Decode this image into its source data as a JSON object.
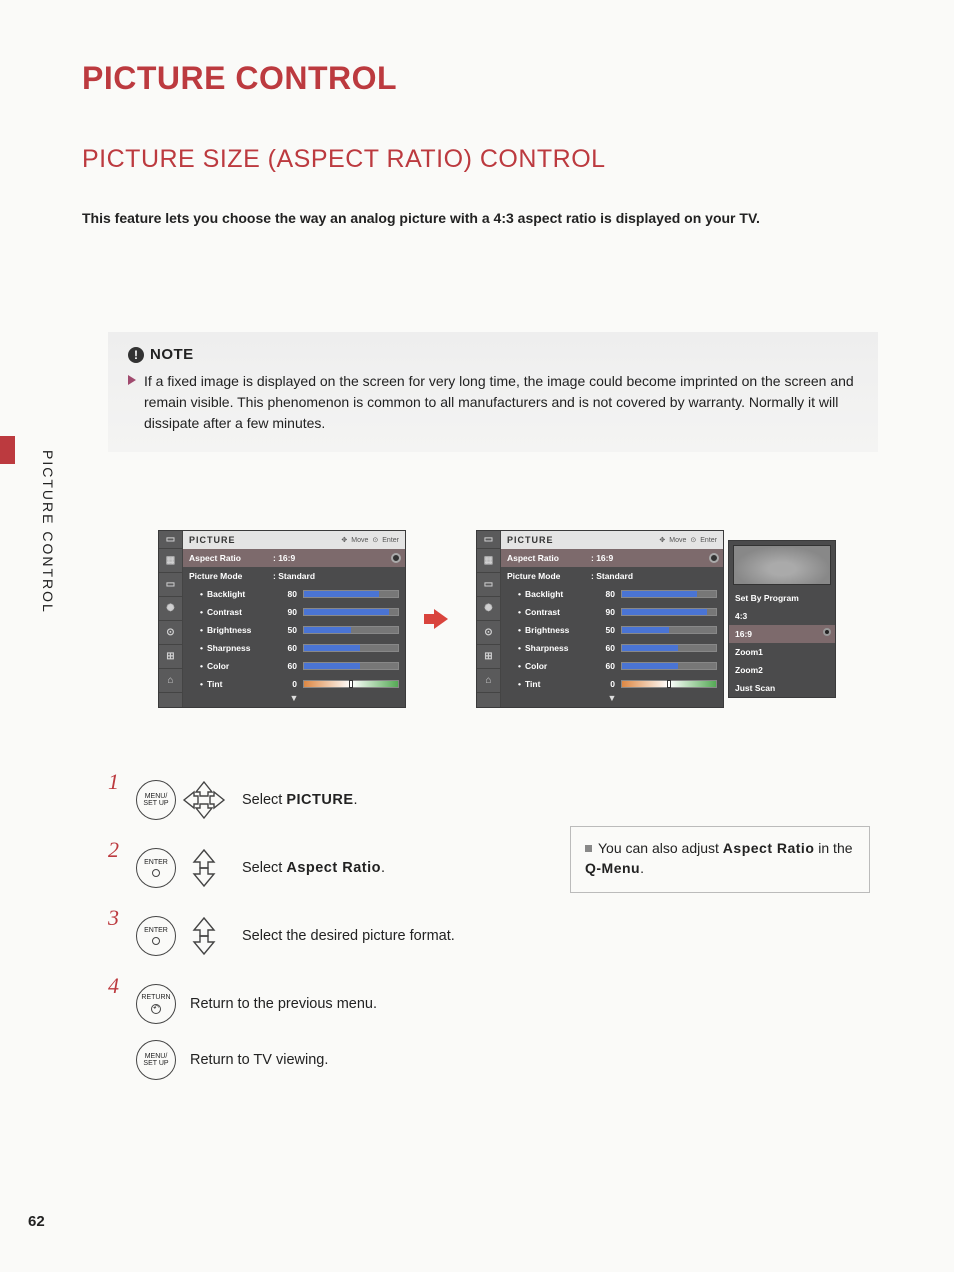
{
  "page_title": "PICTURE CONTROL",
  "section_title": "PICTURE SIZE (ASPECT RATIO) CONTROL",
  "intro": "This feature lets you choose the way an analog picture with a 4:3 aspect ratio is displayed on your TV.",
  "side_label": "PICTURE CONTROL",
  "note": {
    "title": "NOTE",
    "body": "If a fixed image is displayed on the screen for very long time, the image could become imprinted on the screen and remain visible. This phenomenon is common to all manufacturers and is not covered by warranty. Normally it will dissipate after a few minutes."
  },
  "osd": {
    "header_title": "PICTURE",
    "move_label": "Move",
    "enter_label": "Enter",
    "aspect_label": "Aspect Ratio",
    "aspect_value": ": 16:9",
    "mode_label": "Picture Mode",
    "mode_value": ": Standard",
    "settings": [
      {
        "name": "Backlight",
        "value": 80,
        "percent": 80
      },
      {
        "name": "Contrast",
        "value": 90,
        "percent": 90
      },
      {
        "name": "Brightness",
        "value": 50,
        "percent": 50
      },
      {
        "name": "Sharpness",
        "value": 60,
        "percent": 60
      },
      {
        "name": "Color",
        "value": 60,
        "percent": 60
      }
    ],
    "tint_label": "Tint",
    "tint_value": 0
  },
  "popup": {
    "options": [
      "Set By Program",
      "4:3",
      "16:9",
      "Zoom1",
      "Zoom2",
      "Just Scan"
    ],
    "selected": "16:9"
  },
  "steps": {
    "s1": {
      "num": "1",
      "btn": "MENU/\nSET UP",
      "pre": "Select ",
      "kw": "PICTURE",
      "post": "."
    },
    "s2": {
      "num": "2",
      "btn": "ENTER",
      "pre": "Select ",
      "kw": "Aspect Ratio",
      "post": "."
    },
    "s3": {
      "num": "3",
      "btn": "ENTER",
      "text": "Select the desired picture format."
    },
    "s4a": {
      "num": "4",
      "btn": "RETURN",
      "text": "Return to the previous menu."
    },
    "s4b": {
      "btn": "MENU/\nSET UP",
      "text": "Return to TV viewing."
    }
  },
  "tip": {
    "pre": "You can also adjust ",
    "kw1": "Aspect Ratio",
    "mid": " in the ",
    "kw2": "Q-Menu",
    "post": "."
  },
  "page_number": "62"
}
